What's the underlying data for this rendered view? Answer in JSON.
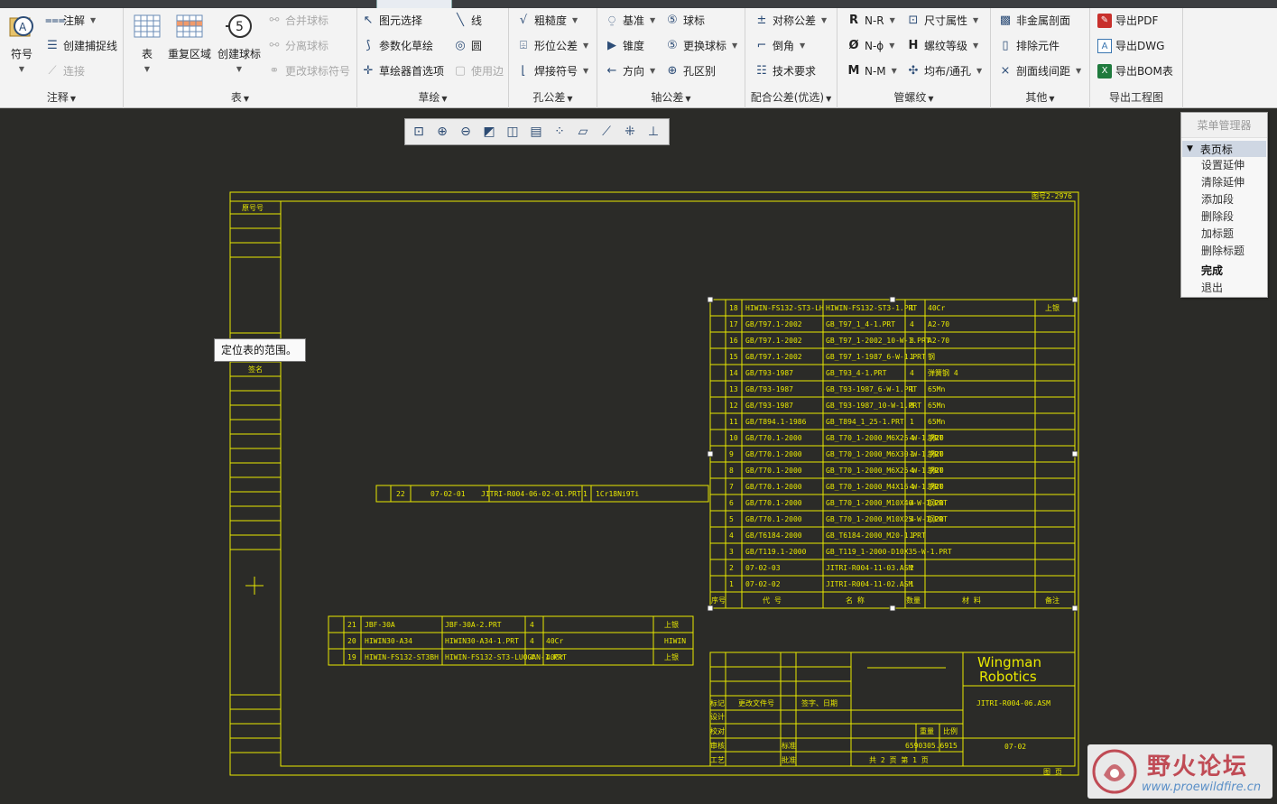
{
  "ribbon": {
    "groups": [
      {
        "label": "注释"
      },
      {
        "label": "表"
      },
      {
        "label": "草绘"
      },
      {
        "label": "孔公差"
      },
      {
        "label": "轴公差"
      },
      {
        "label": "配合公差(优选)"
      },
      {
        "label": "管螺纹"
      },
      {
        "label": "其他"
      },
      {
        "label": "导出工程图"
      }
    ],
    "annotate": {
      "symbol": "符号",
      "note": "注解",
      "capture_line": "创建捕捉线",
      "connect": "连接"
    },
    "table": {
      "table": "表",
      "repeat_region": "重复区域",
      "create_balloon": "创建球标",
      "merge_balloon": "合并球标",
      "split_balloon": "分离球标",
      "change_balloon_symbol": "更改球标符号"
    },
    "sketch": {
      "select": "图元选择",
      "param_sketch": "参数化草绘",
      "sketcher_prefs": "草绘器首选项",
      "line": "线",
      "circle": "圆",
      "use_edge": "使用边"
    },
    "hole_tol": {
      "roughness": "粗糙度",
      "gtol": "形位公差",
      "weld_symbol": "焊接符号"
    },
    "shaft_tol": {
      "datum": "基准",
      "taper": "锥度",
      "direction": "方向",
      "balloon": "球标",
      "replace_balloon": "更换球标",
      "hole_class": "孔区别"
    },
    "fit_tol": {
      "symmetric": "对称公差",
      "chamfer": "倒角",
      "tech_req": "技术要求"
    },
    "pipe": {
      "nr": "N-R",
      "nphi": "N-ϕ",
      "nm": "N-M",
      "size_attr": "尺寸属性",
      "thread_grade": "螺纹等级",
      "uniform_hole": "均布/通孔"
    },
    "other": {
      "non_metal_section": "非金属剖面",
      "exclude_part": "排除元件",
      "section_spacing": "剖面线间距"
    },
    "export": {
      "pdf": "导出PDF",
      "dwg": "导出DWG",
      "bom": "导出BOM表"
    }
  },
  "tooltip": {
    "text": "定位表的范围。"
  },
  "menu_manager": {
    "title": "菜单管理器",
    "section": "表页标",
    "items": [
      "设置延伸",
      "清除延伸",
      "添加段",
      "删除段",
      "加标题",
      "删除标题"
    ],
    "items2": [
      "完成",
      "退出"
    ]
  },
  "drawing": {
    "left_strip": {
      "top_label": "原号号",
      "mid_label": "签名"
    },
    "top_right_code": "图号2-2976",
    "bom_upper": [
      {
        "no": "18",
        "code": "HIWIN-FS132-ST3-LH",
        "name": "HIWIN-FS132-ST3-1.PRT",
        "qty": "1",
        "mat": "40Cr",
        "note": "上银"
      },
      {
        "no": "17",
        "code": "GB/T97.1-2002",
        "name": "GB_T97_1_4-1.PRT",
        "qty": "4",
        "mat": "A2-70",
        "note": ""
      },
      {
        "no": "16",
        "code": "GB/T97.1-2002",
        "name": "GB_T97_1-2002_10-W-1.PRT",
        "qty": "8",
        "mat": "A2-70",
        "note": ""
      },
      {
        "no": "15",
        "code": "GB/T97.1-2002",
        "name": "GB_T97_1-1987_6-W-1.PRT",
        "qty": "1",
        "mat": "钢",
        "note": ""
      },
      {
        "no": "14",
        "code": "GB/T93-1987",
        "name": "GB_T93_4-1.PRT",
        "qty": "4",
        "mat": "弹簧钢 4",
        "note": ""
      },
      {
        "no": "13",
        "code": "GB/T93-1987",
        "name": "GB_T93-1987_6-W-1.PRT",
        "qty": "1",
        "mat": "65Mn",
        "note": ""
      },
      {
        "no": "12",
        "code": "GB/T93-1987",
        "name": "GB_T93-1987_10-W-1.PRT",
        "qty": "8",
        "mat": "65Mn",
        "note": ""
      },
      {
        "no": "11",
        "code": "GB/T894.1-1986",
        "name": "GB_T894_1_25-1.PRT",
        "qty": "1",
        "mat": "65Mn",
        "note": ""
      },
      {
        "no": "10",
        "code": "GB/T70.1-2000",
        "name": "GB_T70_1-2000_M6X25-W-1.PRT",
        "qty": "4",
        "mat": "钢20",
        "note": ""
      },
      {
        "no": "9",
        "code": "GB/T70.1-2000",
        "name": "GB_T70_1-2000_M6X30-W-1.PRT",
        "qty": "1",
        "mat": "钢20",
        "note": ""
      },
      {
        "no": "8",
        "code": "GB/T70.1-2000",
        "name": "GB_T70_1-2000_M6X25-W-1.PRT",
        "qty": "4",
        "mat": "钢20",
        "note": ""
      },
      {
        "no": "7",
        "code": "GB/T70.1-2000",
        "name": "GB_T70_1-2000_M4X16-W-1.PRT",
        "qty": "4",
        "mat": "钢20",
        "note": ""
      },
      {
        "no": "6",
        "code": "GB/T70.1-2000",
        "name": "GB_T70_1-2000_M10X40-W-1.PRT",
        "qty": "4",
        "mat": "钢20",
        "note": ""
      },
      {
        "no": "5",
        "code": "GB/T70.1-2000",
        "name": "GB_T70_1-2000_M10X25-W-1.PRT",
        "qty": "4",
        "mat": "钢20",
        "note": ""
      },
      {
        "no": "4",
        "code": "GB/T6184-2000",
        "name": "GB_T6184-2000_M20-1.PRT",
        "qty": "1",
        "mat": "",
        "note": ""
      },
      {
        "no": "3",
        "code": "GB/T119.1-2000",
        "name": "GB_T119_1-2000-D10X35-W-1.PRT",
        "qty": "",
        "mat": "",
        "note": ""
      },
      {
        "no": "2",
        "code": "07-02-03",
        "name": "JITRI-R004-11-03.ASM",
        "qty": "2",
        "mat": "",
        "note": ""
      },
      {
        "no": "1",
        "code": "07-02-02",
        "name": "JITRI-R004-11-02.ASM",
        "qty": "1",
        "mat": "",
        "note": ""
      }
    ],
    "bom_header": {
      "no": "序号",
      "code": "代   号",
      "name": "名   称",
      "qty": "数量",
      "mat": "材   料",
      "note": "备注"
    },
    "bom_mid": {
      "no": "22",
      "code": "07-02-01",
      "name": "JITRI-R004-06-02-01.PRT",
      "qty": "1",
      "mat": "1Cr18Ni9Ti"
    },
    "bom_lower": [
      {
        "no": "21",
        "code": "JBF-30A",
        "name": "JBF-30A-2.PRT",
        "qty": "4",
        "mat": "",
        "note": "上银"
      },
      {
        "no": "20",
        "code": "HIWIN30-A34",
        "name": "HIWIN30-A34-1.PRT",
        "qty": "4",
        "mat": "40Cr",
        "note": "HIWIN"
      },
      {
        "no": "19",
        "code": "HIWIN-FS132-ST3BH",
        "name": "HIWIN-FS132-ST3-LUOGAN-1.PRT",
        "qty": "4",
        "mat": "40Cr",
        "note": "上银"
      }
    ],
    "title_block": {
      "company1": "Wingman",
      "company2": "Robotics",
      "drawing_no": "JITRI-R004-06.ASM",
      "part_no": "07-02",
      "mark": "标记",
      "change_doc": "更改文件号",
      "sign_date": "签字、日期",
      "design": "设计",
      "check": "校对",
      "review": "审核",
      "process": "工艺",
      "std": "标准",
      "approve": "批准",
      "weight": "重量",
      "scale": "比例",
      "weight_val": "6590305.6915",
      "sheets": "共 2 页 第 1 页",
      "footer": "图 页"
    }
  },
  "watermark": {
    "cn": "野火论坛",
    "url": "www.proewildfire.cn"
  },
  "colors": {
    "background": "#2b2b28",
    "drawing_lines": "#e8e800",
    "ribbon": "#f3f3f3",
    "accent": "#2d4d77"
  }
}
